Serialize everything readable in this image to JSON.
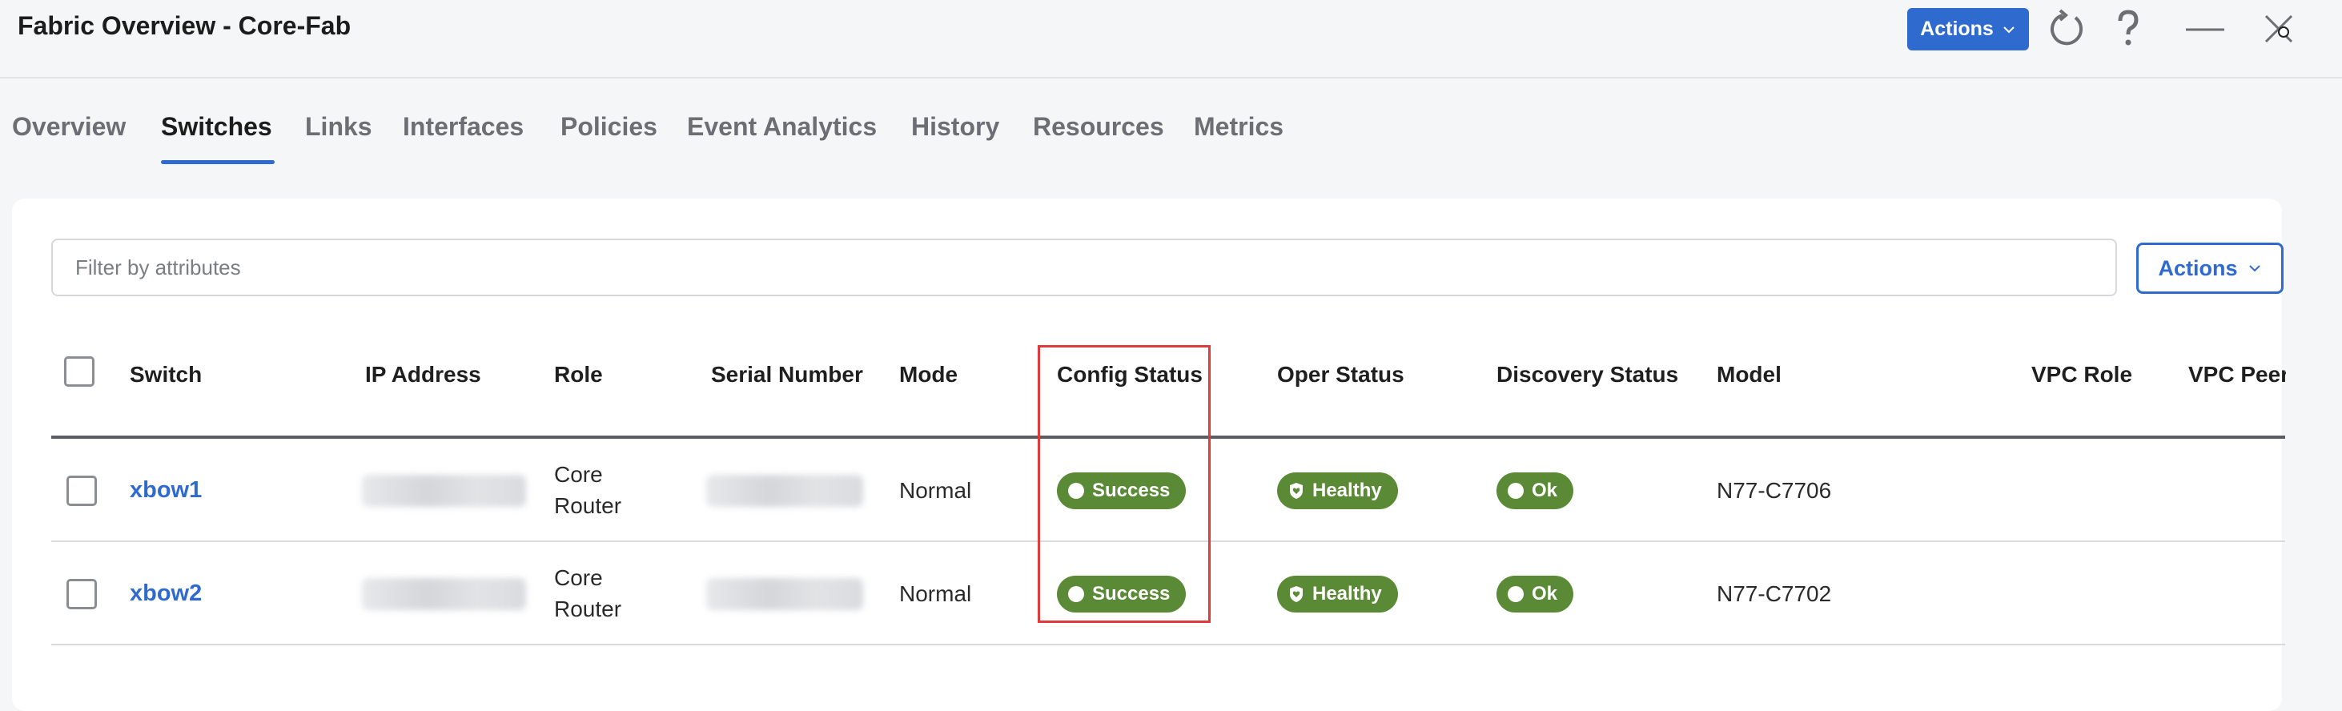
{
  "header": {
    "title": "Fabric Overview - Core-Fab",
    "actions_label": "Actions"
  },
  "icons": {
    "refresh": "refresh-icon",
    "help": "help-icon",
    "minimize": "minimize-icon",
    "close": "close-icon"
  },
  "tabs": [
    {
      "label": "Overview"
    },
    {
      "label": "Switches",
      "active": true
    },
    {
      "label": "Links"
    },
    {
      "label": "Interfaces"
    },
    {
      "label": "Policies"
    },
    {
      "label": "Event Analytics"
    },
    {
      "label": "History"
    },
    {
      "label": "Resources"
    },
    {
      "label": "Metrics"
    }
  ],
  "toolbar": {
    "filter_placeholder": "Filter by attributes",
    "actions_label": "Actions"
  },
  "table": {
    "columns": [
      "Switch",
      "IP Address",
      "Role",
      "Serial Number",
      "Mode",
      "Config Status",
      "Oper Status",
      "Discovery Status",
      "Model",
      "VPC Role",
      "VPC Peer"
    ],
    "rows": [
      {
        "switch": "xbow1",
        "role_line1": "Core",
        "role_line2": "Router",
        "mode": "Normal",
        "config_status": "Success",
        "oper_status": "Healthy",
        "discovery_status": "Ok",
        "model": "N77-C7706"
      },
      {
        "switch": "xbow2",
        "role_line1": "Core",
        "role_line2": "Router",
        "mode": "Normal",
        "config_status": "Success",
        "oper_status": "Healthy",
        "discovery_status": "Ok",
        "model": "N77-C7702"
      }
    ]
  },
  "colors": {
    "accent": "#2f6bcf",
    "status_green": "#5a8a36",
    "highlight_red": "#e03a3a"
  }
}
